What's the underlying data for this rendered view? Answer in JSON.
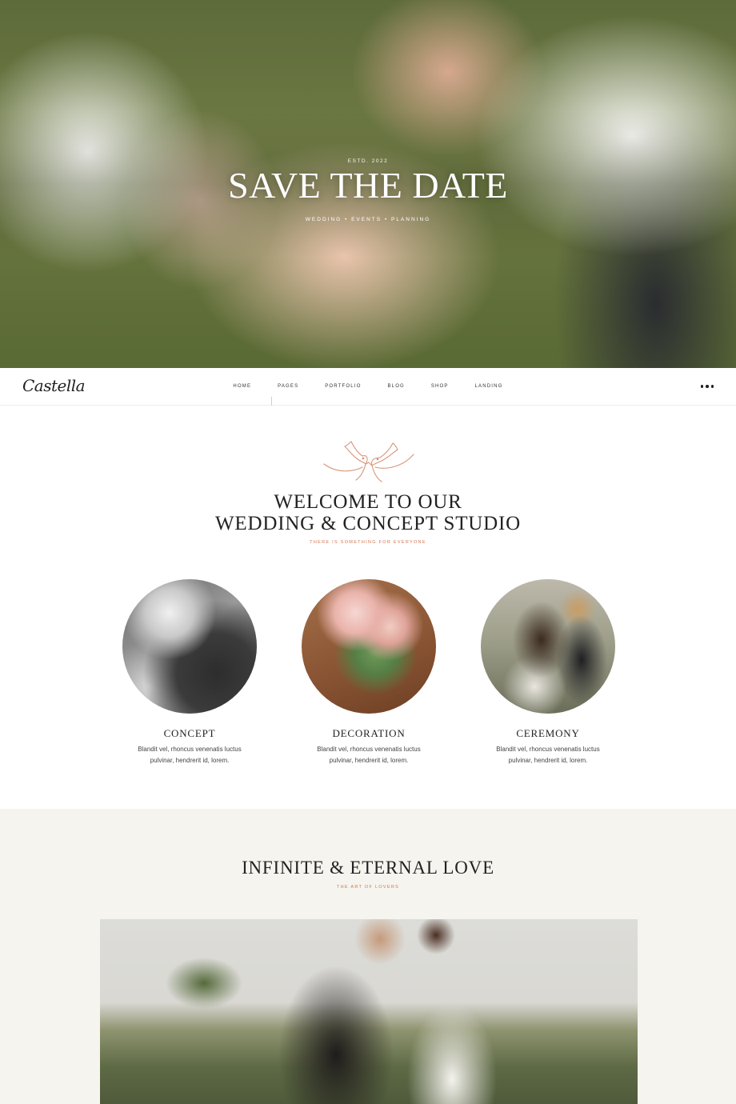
{
  "hero": {
    "estd": "ESTD. 2022",
    "title": "SAVE THE DATE",
    "subtitle": "WEDDING • EVENTS • PLANNING"
  },
  "nav": {
    "logo": "Castella",
    "menu": [
      "HOME",
      "PAGES",
      "PORTFOLIO",
      "BLOG",
      "SHOP",
      "LANDING"
    ],
    "more_icon": "more-dots-icon"
  },
  "welcome": {
    "title_line1": "WELCOME TO OUR",
    "title_line2": "WEDDING & CONCEPT STUDIO",
    "subtitle": "THERE IS SOMETHING FOR EVERYONE",
    "emblem_icon": "doves-icon",
    "accent_color": "#d0764f",
    "cards": [
      {
        "title": "CONCEPT",
        "text_line1": "Blandit vel, rhoncus venenatis luctus",
        "text_line2": "pulvinar, hendrerit id, lorem."
      },
      {
        "title": "DECORATION",
        "text_line1": "Blandit vel, rhoncus venenatis luctus",
        "text_line2": "pulvinar, hendrerit id, lorem."
      },
      {
        "title": "CEREMONY",
        "text_line1": "Blandit vel, rhoncus venenatis luctus",
        "text_line2": "pulvinar, hendrerit id, lorem."
      }
    ]
  },
  "love": {
    "title": "INFINITE & ETERNAL LOVE",
    "subtitle": "THE ART OF LOVERS",
    "background": "#f5f4ee"
  }
}
